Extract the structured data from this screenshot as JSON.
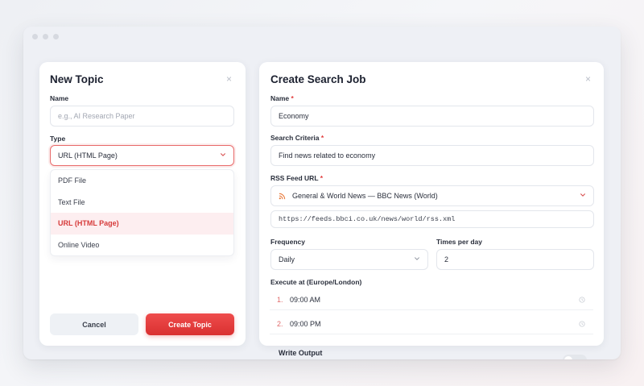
{
  "new_topic": {
    "title": "New Topic",
    "close_glyph": "×",
    "name_label": "Name",
    "name_placeholder": "e.g., AI Research Paper",
    "type_label": "Type",
    "type_value": "URL (HTML Page)",
    "type_options": [
      "PDF File",
      "Text File",
      "URL (HTML Page)",
      "Online Video"
    ],
    "cancel_label": "Cancel",
    "create_label": "Create Topic"
  },
  "search_job": {
    "title": "Create Search Job",
    "close_glyph": "×",
    "name_label": "Name",
    "name_value": "Economy",
    "criteria_label": "Search Criteria",
    "criteria_value": "Find news related to economy",
    "rss_label": "RSS Feed URL",
    "rss_selected": "General & World News — BBC News (World)",
    "rss_url": "https://feeds.bbci.co.uk/news/world/rss.xml",
    "frequency_label": "Frequency",
    "frequency_value": "Daily",
    "times_label": "Times per day",
    "times_value": "2",
    "execute_label": "Execute at (Europe/London)",
    "times": [
      {
        "num": "1.",
        "time": "09:00 AM"
      },
      {
        "num": "2.",
        "time": "09:00 PM"
      }
    ],
    "write_output_label": "Write Output",
    "required_marker": "*"
  },
  "colors": {
    "accent": "#e23b3b",
    "selected_bg": "#fdeef0"
  },
  "icons": [
    "close-icon",
    "chevron-down-icon",
    "rss-icon",
    "clock-icon"
  ]
}
